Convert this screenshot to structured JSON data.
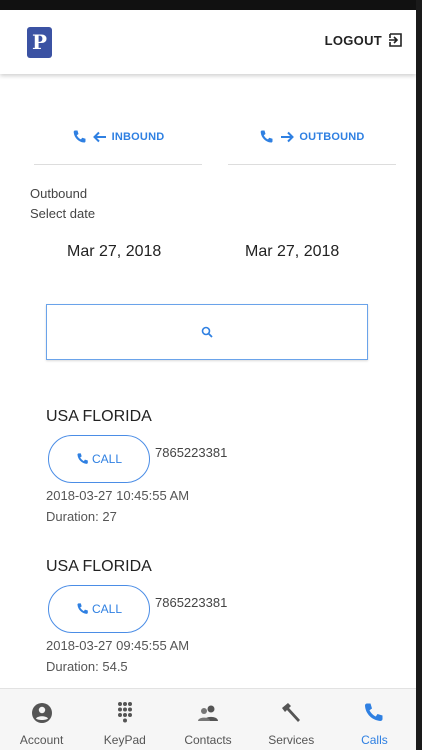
{
  "header": {
    "logo_text": "P",
    "logout_label": "LOGOUT"
  },
  "tabs": [
    {
      "label": "INBOUND"
    },
    {
      "label": "OUTBOUND"
    }
  ],
  "section": {
    "title": "Outbound",
    "subtitle": "Select date"
  },
  "dates": {
    "from": "Mar 27, 2018",
    "to": "Mar 27, 2018"
  },
  "calls": [
    {
      "place": "USA FLORIDA",
      "button_label": "CALL",
      "number": "7865223381",
      "time": "2018-03-27 10:45:55 AM",
      "duration": "Duration: 27"
    },
    {
      "place": "USA FLORIDA",
      "button_label": "CALL",
      "number": "7865223381",
      "time": "2018-03-27 09:45:55 AM",
      "duration": "Duration: 54.5"
    }
  ],
  "nav": [
    {
      "label": "Account",
      "icon": "account-icon"
    },
    {
      "label": "KeyPad",
      "icon": "keypad-icon"
    },
    {
      "label": "Contacts",
      "icon": "contacts-icon"
    },
    {
      "label": "Services",
      "icon": "hammer-icon"
    },
    {
      "label": "Calls",
      "icon": "phone-icon"
    }
  ],
  "colors": {
    "accent": "#2f80e2",
    "logo": "#3b52a3"
  }
}
